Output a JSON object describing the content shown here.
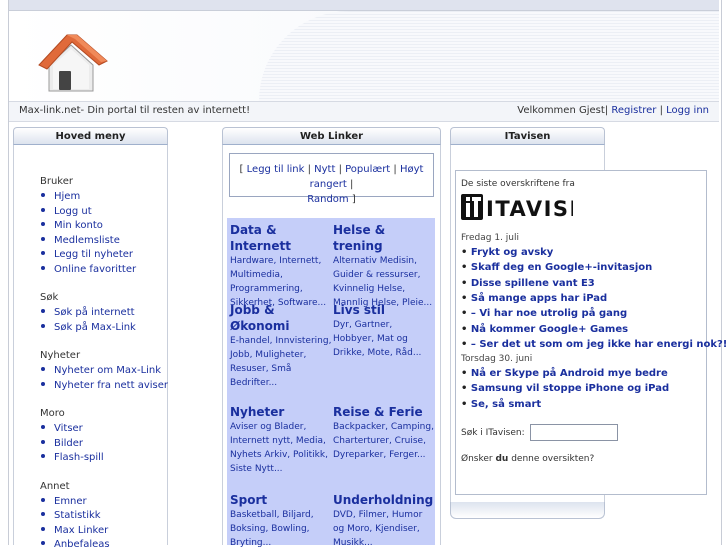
{
  "header": {
    "tagline": "Max-link.net- Din portal til resten av internett!",
    "welcome": "Velkommen Gjest",
    "register": "Registrer",
    "login": "Logg inn"
  },
  "menu": {
    "title": "Hoved meny",
    "groups": [
      {
        "label": "Bruker",
        "items": [
          "Hjem",
          "Logg ut",
          "Min konto",
          "Medlemsliste",
          "Legg til nyheter",
          "Online favoritter"
        ]
      },
      {
        "label": "Søk",
        "items": [
          "Søk på internett",
          "Søk på Max-Link"
        ]
      },
      {
        "label": "Nyheter",
        "items": [
          "Nyheter om Max-Link",
          "Nyheter fra nett aviser"
        ]
      },
      {
        "label": "Moro",
        "items": [
          "Vitser",
          "Bilder",
          "Flash-spill"
        ]
      },
      {
        "label": "Annet",
        "items": [
          "Emner",
          "Statistikk",
          "Max Linker",
          "Anbefaleas"
        ]
      }
    ]
  },
  "weblinks": {
    "title": "Web Linker",
    "actions": {
      "add": "Legg til link",
      "new": "Nytt",
      "popular": "Populært",
      "top": "Høyt rangert",
      "random": "Random"
    },
    "categories": [
      {
        "title": "Data & Internett",
        "sub": "Hardware, Internett, Multimedia, Programmering, Sikkerhet, Software..."
      },
      {
        "title": "Helse & trening",
        "sub": "Alternativ Medisin, Guider & ressurser, Kvinnelig Helse, Mannlig Helse, Pleie..."
      },
      {
        "title": "Jobb & Økonomi",
        "sub": "E-handel, Innvistering, Jobb, Muligheter, Resuser, Små Bedrifter..."
      },
      {
        "title": "Livs stil",
        "sub": "Dyr, Gartner, Hobbyer, Mat og Drikke, Mote, Råd..."
      },
      {
        "title": "Nyheter",
        "sub": "Aviser og Blader, Internett nytt, Media, Nyhets Arkiv, Politikk, Siste Nytt..."
      },
      {
        "title": "Reise & Ferie",
        "sub": "Backpacker, Camping, Charterturer, Cruise, Dyreparker, Ferger..."
      },
      {
        "title": "Sport",
        "sub": "Basketball, Biljard, Boksing, Bowling, Bryting..."
      },
      {
        "title": "Underholdning",
        "sub": "DVD, Filmer, Humor og Moro, Kjendiser, Musikk..."
      }
    ]
  },
  "itavisen": {
    "title": "ITavisen",
    "lead": "De siste overskriftene fra",
    "logo_text": "ITAVISEN",
    "days": [
      {
        "date": "Fredag 1. juli",
        "items": [
          "Frykt og avsky",
          "Skaff deg en Google+-invitasjon",
          "Disse spillene vant E3",
          "Så mange apps har iPad",
          "– Vi har noe utrolig på gang",
          "Nå kommer Google+ Games",
          "– Ser det ut som om jeg ikke har energi nok?!"
        ]
      },
      {
        "date": "Torsdag 30. juni",
        "items": [
          "Nå er Skype på Android mye bedre",
          "Samsung vil stoppe iPhone og iPad",
          "Se, så smart"
        ]
      }
    ],
    "search_label": "Søk i ITavisen:",
    "search_value": "",
    "more_prefix": "Ønsker ",
    "more_bold": "du",
    "more_suffix": " denne oversikten?"
  },
  "colors": {
    "link": "#1a2f9e",
    "category_bg": "#c5cef9",
    "roof": "#e06a3a"
  }
}
